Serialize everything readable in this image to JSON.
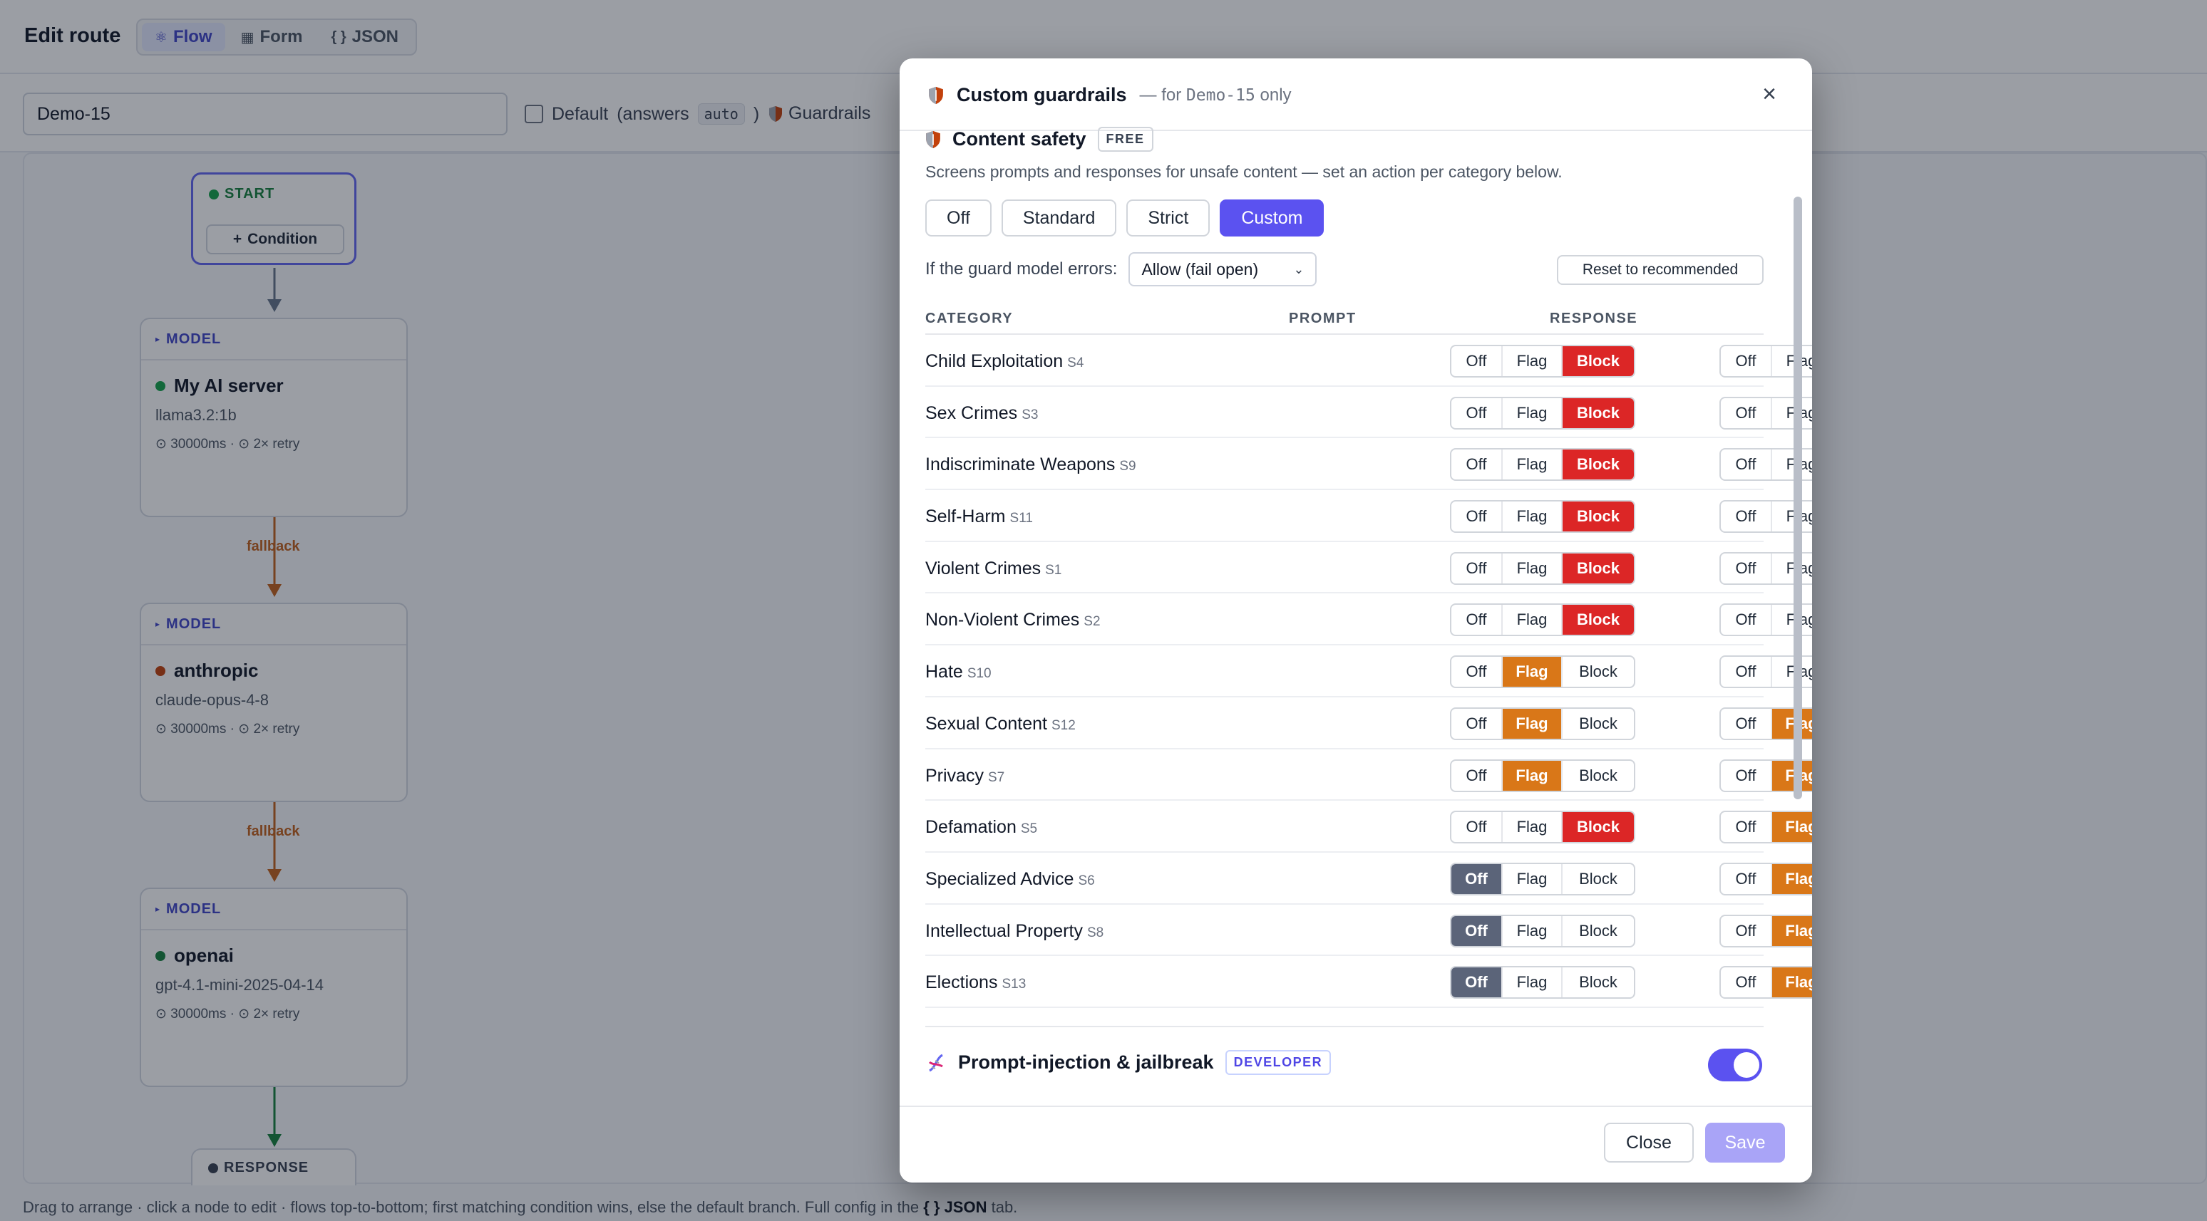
{
  "page": {
    "title": "Edit route",
    "view_tabs": [
      {
        "icon": "flow-icon",
        "glyph": "⚛",
        "label": "Flow"
      },
      {
        "icon": "form-icon",
        "glyph": "▦",
        "label": "Form"
      },
      {
        "icon": "json-icon",
        "glyph": "{ }",
        "label": "JSON"
      }
    ],
    "route_name": "Demo-15",
    "default_label": "Default",
    "default_hint_prefix": "(answers",
    "default_hint_code": "auto",
    "default_hint_suffix": ")",
    "guardrails_label": "Guardrails"
  },
  "flow": {
    "start_label": "START",
    "condition_button": "Condition",
    "nodes": [
      {
        "type_label": "MODEL",
        "name": "My AI server",
        "model": "llama3.2:1b",
        "meta": "⊙ 30000ms · ⊙ 2× retry",
        "status_color": "#16a34a"
      },
      {
        "type_label": "MODEL",
        "name": "anthropic",
        "model": "claude-opus-4-8",
        "meta": "⊙ 30000ms · ⊙ 2× retry",
        "status_color": "#c2410c"
      },
      {
        "type_label": "MODEL",
        "name": "openai",
        "model": "gpt-4.1-mini-2025-04-14",
        "meta": "⊙ 30000ms · ⊙ 2× retry",
        "status_color": "#15803d"
      }
    ],
    "edge_labels": [
      "fallback",
      "fallback"
    ],
    "response_label": "RESPONSE",
    "footer_hint_before": "Drag to arrange · click a node to edit · flows top-to-bottom; first matching condition wins, else the default branch. Full config in the",
    "footer_hint_bold": "{ } JSON",
    "footer_hint_after": "tab."
  },
  "modal": {
    "title": "Custom guardrails",
    "subtitle_prefix": "— for",
    "subtitle_code": "Demo-15",
    "subtitle_suffix": "only",
    "content_safety": {
      "title": "Content safety",
      "badge": "FREE",
      "description": "Screens prompts and responses for unsafe content — set an action per category below.",
      "presets": [
        "Off",
        "Standard",
        "Strict",
        "Custom"
      ],
      "active_preset": "Custom",
      "fail_mode_label": "If the guard model errors:",
      "fail_mode_value": "Allow (fail open)",
      "reset_label": "Reset to recommended",
      "headers": {
        "category": "CATEGORY",
        "prompt": "PROMPT",
        "response": "RESPONSE"
      },
      "option_labels": {
        "off": "Off",
        "flag": "Flag",
        "block": "Block"
      },
      "categories": [
        {
          "name": "Child Exploitation",
          "code": "S4",
          "prompt": "block",
          "response": "block"
        },
        {
          "name": "Sex Crimes",
          "code": "S3",
          "prompt": "block",
          "response": "block"
        },
        {
          "name": "Indiscriminate Weapons",
          "code": "S9",
          "prompt": "block",
          "response": "block"
        },
        {
          "name": "Self-Harm",
          "code": "S11",
          "prompt": "block",
          "response": "block"
        },
        {
          "name": "Violent Crimes",
          "code": "S1",
          "prompt": "block",
          "response": "block"
        },
        {
          "name": "Non-Violent Crimes",
          "code": "S2",
          "prompt": "block",
          "response": "block"
        },
        {
          "name": "Hate",
          "code": "S10",
          "prompt": "flag",
          "response": "block"
        },
        {
          "name": "Sexual Content",
          "code": "S12",
          "prompt": "flag",
          "response": "flag"
        },
        {
          "name": "Privacy",
          "code": "S7",
          "prompt": "flag",
          "response": "flag"
        },
        {
          "name": "Defamation",
          "code": "S5",
          "prompt": "block",
          "response": "flag"
        },
        {
          "name": "Specialized Advice",
          "code": "S6",
          "prompt": "off",
          "response": "flag"
        },
        {
          "name": "Intellectual Property",
          "code": "S8",
          "prompt": "off",
          "response": "flag"
        },
        {
          "name": "Elections",
          "code": "S13",
          "prompt": "off",
          "response": "flag"
        }
      ]
    },
    "prompt_injection": {
      "title": "Prompt-injection & jailbreak",
      "badge": "DEVELOPER",
      "enabled": true
    },
    "footer": {
      "close_label": "Close",
      "save_label": "Save"
    }
  }
}
